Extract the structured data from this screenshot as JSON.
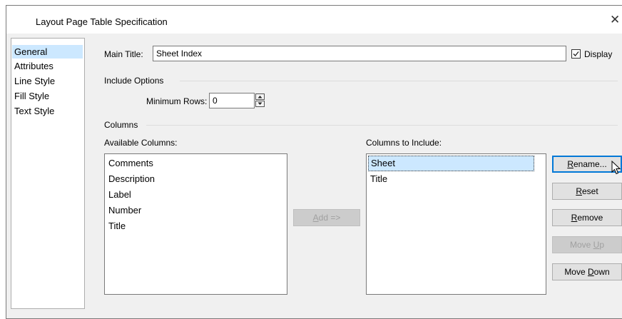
{
  "dialog": {
    "title": "Layout Page Table Specification",
    "close_icon": "✕"
  },
  "nav": {
    "items": [
      {
        "label": "General",
        "selected": true
      },
      {
        "label": "Attributes",
        "selected": false
      },
      {
        "label": "Line Style",
        "selected": false
      },
      {
        "label": "Fill Style",
        "selected": false
      },
      {
        "label": "Text Style",
        "selected": false
      }
    ]
  },
  "general": {
    "main_title_label": "Main Title:",
    "main_title_value": "Sheet Index",
    "display_label": "Display",
    "display_checked": true,
    "include_options_label": "Include Options",
    "minimum_rows_label": "Minimum Rows:",
    "minimum_rows_value": "0",
    "columns_label": "Columns",
    "available_columns_label": "Available Columns:",
    "available_columns": [
      "Comments",
      "Description",
      "Label",
      "Number",
      "Title"
    ],
    "columns_to_include_label": "Columns to Include:",
    "included_columns": [
      "Sheet",
      "Title"
    ],
    "selected_included": "Sheet"
  },
  "buttons": {
    "add": {
      "text": "Add =>",
      "mnemonic": "A",
      "enabled": false
    },
    "rename": {
      "text": "Rename...",
      "mnemonic": "R",
      "enabled": true
    },
    "reset": {
      "text": "Reset",
      "mnemonic": "R",
      "enabled": true
    },
    "remove": {
      "text": "Remove",
      "mnemonic": "R",
      "enabled": true
    },
    "move_up": {
      "text": "Move Up",
      "mnemonic": "U",
      "enabled": false
    },
    "move_down": {
      "text": "Move Down",
      "mnemonic": "D",
      "enabled": true
    }
  },
  "colors": {
    "selection": "#cce8ff",
    "default_button_border": "#0078d7",
    "dialog_bg": "#f0f0f0"
  }
}
